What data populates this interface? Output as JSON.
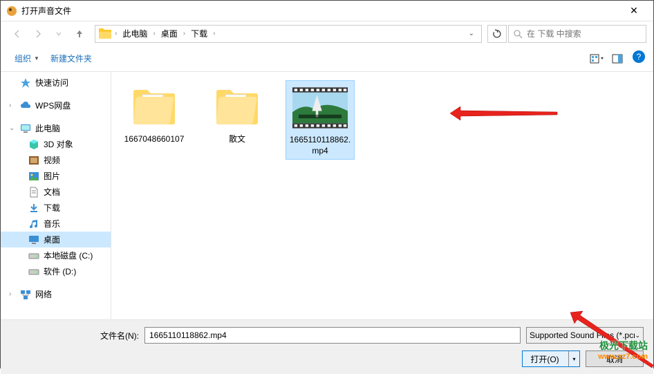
{
  "title": "打开声音文件",
  "breadcrumb": {
    "items": [
      "此电脑",
      "桌面",
      "下载"
    ]
  },
  "search": {
    "placeholder": "在 下载 中搜索"
  },
  "toolbar": {
    "organize": "组织",
    "newfolder": "新建文件夹"
  },
  "sidebar": {
    "quickaccess": "快速访问",
    "wps": "WPS网盘",
    "thispc": "此电脑",
    "objects3d": "3D 对象",
    "videos": "视频",
    "pictures": "图片",
    "documents": "文档",
    "downloads": "下载",
    "music": "音乐",
    "desktop": "桌面",
    "disk_c": "本地磁盘 (C:)",
    "disk_d": "软件 (D:)",
    "network": "网络"
  },
  "files": [
    {
      "name": "1667048660107",
      "type": "folder"
    },
    {
      "name": "散文",
      "type": "folder"
    },
    {
      "name": "1665110118862.mp4",
      "type": "video",
      "selected": true
    }
  ],
  "footer": {
    "filename_label": "文件名(N):",
    "filename_value": "1665110118862.mp4",
    "filetype": "Supported Sound Files (*.pcm",
    "open": "打开(O)",
    "cancel": "取消"
  },
  "watermark": {
    "line1": "极光下载站",
    "line2": "www.xz7.com"
  }
}
